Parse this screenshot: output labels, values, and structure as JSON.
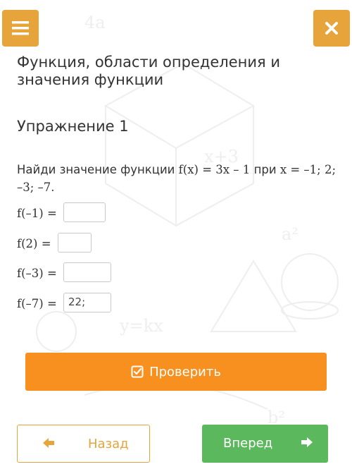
{
  "header": {
    "menu_icon": "hamburger-icon",
    "close_icon": "close-icon",
    "accent_color": "#e6a43a"
  },
  "lesson": {
    "title": "Функция, области определения и значения функции",
    "exercise": "Упражнение 1"
  },
  "task": {
    "prefix": "Найди значение функции",
    "function": "f(x) = 3x – 1",
    "connector": "при",
    "values": "x = –1; 2; –3; –7."
  },
  "answers": [
    {
      "label": "f(–1) =",
      "value": ""
    },
    {
      "label": "f(2) =",
      "value": ""
    },
    {
      "label": "f(–3) =",
      "value": ""
    },
    {
      "label": "f(–7) =",
      "value": "22;"
    }
  ],
  "actions": {
    "check_label": "Проверить",
    "check_icon": "checkbox-icon",
    "check_color": "#f7901e",
    "back_label": "Назад",
    "back_icon": "arrow-left-icon",
    "next_label": "Вперед",
    "next_icon": "arrow-right-icon",
    "next_color": "#5cb85c"
  }
}
